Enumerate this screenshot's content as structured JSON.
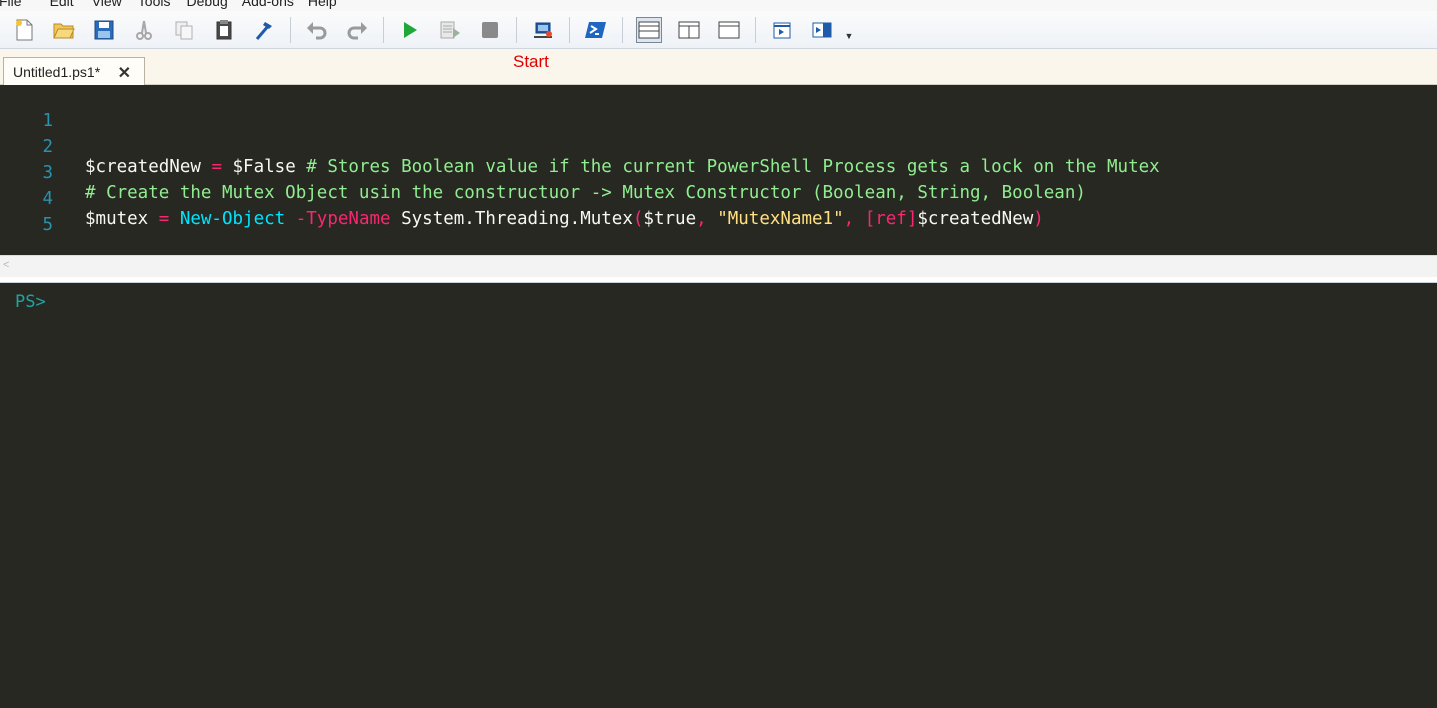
{
  "menu": {
    "items": [
      "File",
      "Edit",
      "View",
      "Tools",
      "Debug",
      "Add-ons",
      "Help"
    ]
  },
  "toolbar": {
    "buttons": [
      {
        "name": "new-icon"
      },
      {
        "name": "open-icon"
      },
      {
        "name": "save-icon"
      },
      {
        "name": "cut-icon"
      },
      {
        "name": "copy-icon"
      },
      {
        "name": "paste-icon"
      },
      {
        "name": "clear-console-icon"
      },
      {
        "name": "undo-icon"
      },
      {
        "name": "redo-icon"
      },
      {
        "name": "run-script-icon"
      },
      {
        "name": "run-selection-icon"
      },
      {
        "name": "stop-icon"
      },
      {
        "name": "new-remote-tab-icon"
      },
      {
        "name": "start-powershell-icon"
      },
      {
        "name": "show-script-top-icon"
      },
      {
        "name": "show-script-right-icon"
      },
      {
        "name": "show-script-max-icon"
      },
      {
        "name": "show-command-window-icon"
      },
      {
        "name": "show-command-addon-icon"
      }
    ]
  },
  "tab": {
    "label": "Untitled1.ps1*",
    "close_glyph": "✕"
  },
  "annotation": {
    "start_label": "Start"
  },
  "editor": {
    "line_numbers": [
      "1",
      "2",
      "3",
      "4",
      "5"
    ],
    "line2": {
      "var": "$createdNew",
      "eq": " = ",
      "val": "$False",
      "comment": " # Stores Boolean value if the current PowerShell Process gets a lock on the Mutex"
    },
    "line3": {
      "comment": "# Create the Mutex Object usin the constructuor -> Mutex Constructor (Boolean, String, Boolean)"
    },
    "line4": {
      "var": "$mutex",
      "eq": " = ",
      "cmd": "New-Object",
      "param": " -TypeName",
      "type": " System.Threading.Mutex",
      "paren_open": "(",
      "arg1": "$true",
      "comma1": ", ",
      "arg2": "\"MutexName1\"",
      "comma2": ", ",
      "ref": "[ref]",
      "arg3": "$createdNew",
      "paren_close": ")"
    }
  },
  "console": {
    "prompt": "PS>"
  },
  "colors": {
    "editor_bg": "#272822",
    "console_bg": "#272822",
    "line_number": "#2b91af",
    "comment": "#90ee90",
    "cmdlet": "#00e5ff",
    "operator": "#f92672",
    "string": "#ffe080",
    "prompt": "#1fa3a3",
    "start_label": "#e00000"
  }
}
